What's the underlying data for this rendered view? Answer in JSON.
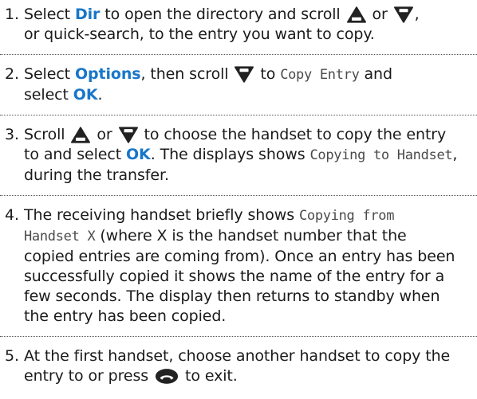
{
  "steps": [
    {
      "number": "1.",
      "t1": "Select ",
      "kw1": "Dir",
      "t2": " to open the directory and scroll ",
      "t3": " or ",
      "t4": ",",
      "t5": "or quick-search, to the entry you want to copy."
    },
    {
      "number": "2.",
      "t1": "Select ",
      "kw1": "Options",
      "t2": ", then scroll ",
      "t3": " to ",
      "lcd1": "Copy Entry",
      "t4": " and",
      "t5": "select ",
      "kw2": "OK",
      "t6": "."
    },
    {
      "number": "3.",
      "t1": "Scroll ",
      "t2": " or ",
      "t3": " to choose the handset to copy the entry",
      "t4": "to and select ",
      "kw1": "OK",
      "t5": ". The displays shows ",
      "lcd1": "Copying to Handset",
      "t6": ",",
      "t7": "during the transfer."
    },
    {
      "number": "4.",
      "t1": "The receiving handset briefly shows ",
      "lcd1": "Copying from",
      "lcd2": "Handset X",
      "t2": " (where X is the handset number that the",
      "t3": "copied entries are coming from). Once an entry has been",
      "t4": "successfully copied it shows the name of the entry for a",
      "t5": "few seconds. The display then returns to standby when",
      "t6": "the entry has been copied."
    },
    {
      "number": "5.",
      "t1": "At the first handset, choose another handset to copy the",
      "t2": "entry to or press ",
      "t3": " to exit."
    }
  ],
  "icons": {
    "up": {
      "name": "redial-up-arrow-icon",
      "label": "Redial"
    },
    "down": {
      "name": "calls-down-arrow-icon",
      "label": "Calls"
    },
    "end": {
      "name": "end-call-icon"
    }
  },
  "colors": {
    "keyword": "#1876c9",
    "text": "#1a1a1a",
    "lcd_text": "#4a4a4a",
    "icon": "#222222"
  }
}
